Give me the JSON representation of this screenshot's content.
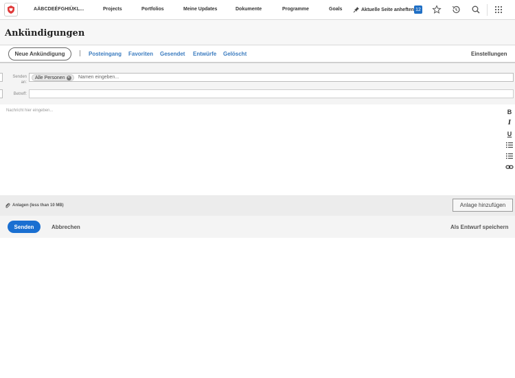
{
  "nav": {
    "org": "AÄBCDEÉFGHIÜKL...",
    "items": [
      "Projects",
      "Portfolios",
      "Meine Updates",
      "Dokumente",
      "Programme",
      "Goals"
    ],
    "pin_label": "Aktuelle Seite anheften",
    "notifications": "12",
    "icons": [
      "star-icon",
      "history-icon",
      "search-icon",
      "apps-grid-icon"
    ]
  },
  "page": {
    "title": "Ankündigungen"
  },
  "tabs": {
    "new_button": "Neue Ankündigung",
    "items": [
      "Posteingang",
      "Favoriten",
      "Gesendet",
      "Entwürfe",
      "Gelöscht"
    ],
    "settings": "Einstellungen"
  },
  "compose": {
    "to_label_1": "Senden",
    "to_label_2": "an:",
    "recipient_chip": "Alle Personen",
    "to_placeholder": "Namen eingeben...",
    "subject_label": "Betreff:",
    "subject_value": "",
    "message_placeholder": "Nachricht hier eingeben..."
  },
  "format_tools": [
    "B",
    "I",
    "U",
    "bulleted-list",
    "numbered-list",
    "link"
  ],
  "attachments": {
    "label": "Anlagen (less than 10 MB)",
    "add_button": "Anlage hinzufügen"
  },
  "actions": {
    "send": "Senden",
    "cancel": "Abbrechen",
    "save_draft": "Als Entwurf speichern"
  },
  "colors": {
    "accent": "#1a6fd1",
    "link": "#3a7bbf",
    "logo": "#e03a3a"
  }
}
